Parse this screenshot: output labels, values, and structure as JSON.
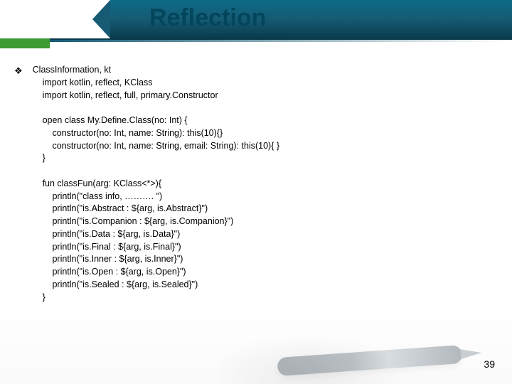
{
  "title": "Reflection",
  "bullet_glyph": "❖",
  "file_label": "ClassInformation, kt",
  "imports": [
    "import kotlin, reflect, KClass",
    "import kotlin, reflect, full, primary.Constructor"
  ],
  "class_decl": {
    "open_line": "open class My.Define.Class(no: Int) {",
    "ctor1": "constructor(no: Int, name: String): this(10){}",
    "ctor2": "constructor(no: Int, name: String, email: String): this(10){ }",
    "close": "}"
  },
  "fun_decl": {
    "open_line": "fun classFun(arg: KClass<*>){",
    "lines": [
      "println(\"class info, ………. \")",
      "println(\"is.Abstract : ${arg, is.Abstract}\")",
      "println(\"is.Companion : ${arg, is.Companion}\")",
      "println(\"is.Data : ${arg, is.Data}\")",
      "println(\"is.Final : ${arg, is.Final}\")",
      "println(\"is.Inner : ${arg, is.Inner}\")",
      "println(\"is.Open : ${arg, is.Open}\")",
      "println(\"is.Sealed : ${arg, is.Sealed}\")"
    ],
    "close": "}"
  },
  "page_number": "39"
}
